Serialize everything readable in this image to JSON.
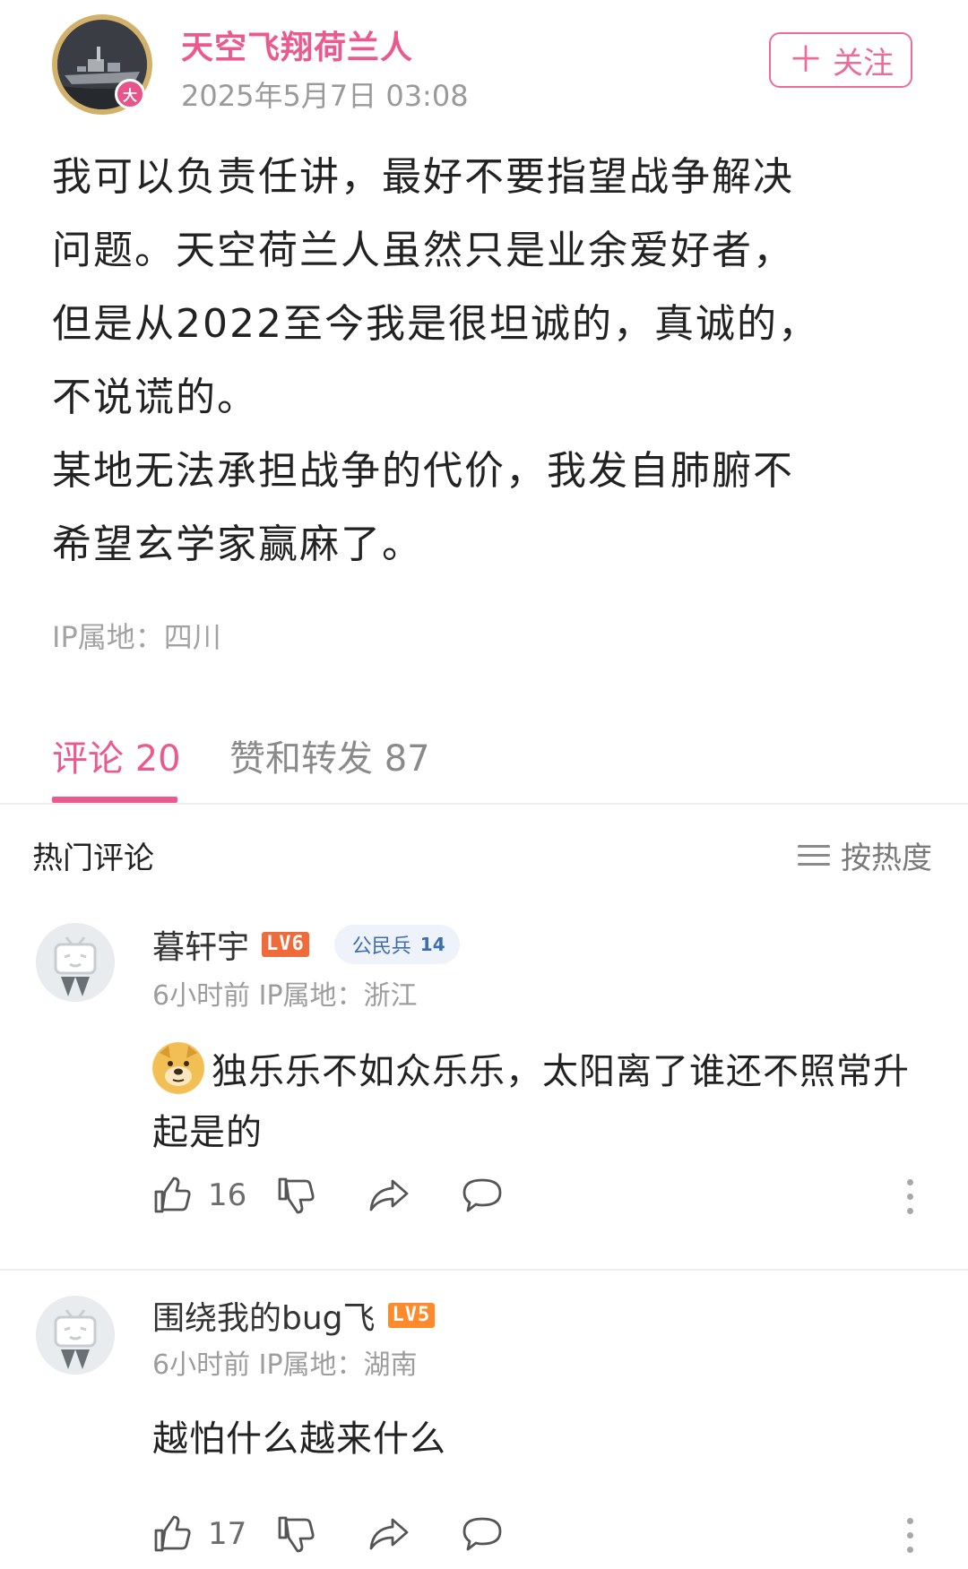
{
  "post": {
    "author_name": "天空飞翔荷兰人",
    "avatar_badge": "大",
    "time": "2025年5月7日 03:08",
    "follow_label": "关注",
    "body": "我可以负责任讲，最好不要指望战争解决\n问题。天空荷兰人虽然只是业余爱好者，\n但是从2022至今我是很坦诚的，真诚的，\n不说谎的。\n某地无法承担战争的代价，我发自肺腑不\n希望玄学家赢麻了。",
    "ip_location": "IP属地：四川"
  },
  "tabs": [
    {
      "label": "评论 20",
      "active": true
    },
    {
      "label": "赞和转发 87",
      "active": false
    }
  ],
  "comments_header": {
    "title": "热门评论",
    "sort_label": "按热度"
  },
  "comments": [
    {
      "user": "暮轩宇",
      "level": "LV6",
      "citizen_badge": "公民兵",
      "citizen_level": "14",
      "meta": "6小时前 IP属地：浙江",
      "emoji": "doge-emoji",
      "text": "独乐乐不如众乐乐，太阳离了谁还不照常升起是的",
      "likes": "16"
    },
    {
      "user": "围绕我的bug飞",
      "level": "LV5",
      "meta": "6小时前 IP属地：湖南",
      "text": "越怕什么越来什么",
      "likes": "17"
    }
  ],
  "colors": {
    "accent": "#eb5a8f",
    "muted": "#9d9d9d",
    "level6": "#f06b3a",
    "level5": "#ff8a2b"
  },
  "icons": [
    "like-icon",
    "dislike-icon",
    "share-icon",
    "reply-icon",
    "more-icon",
    "menu-icon"
  ]
}
